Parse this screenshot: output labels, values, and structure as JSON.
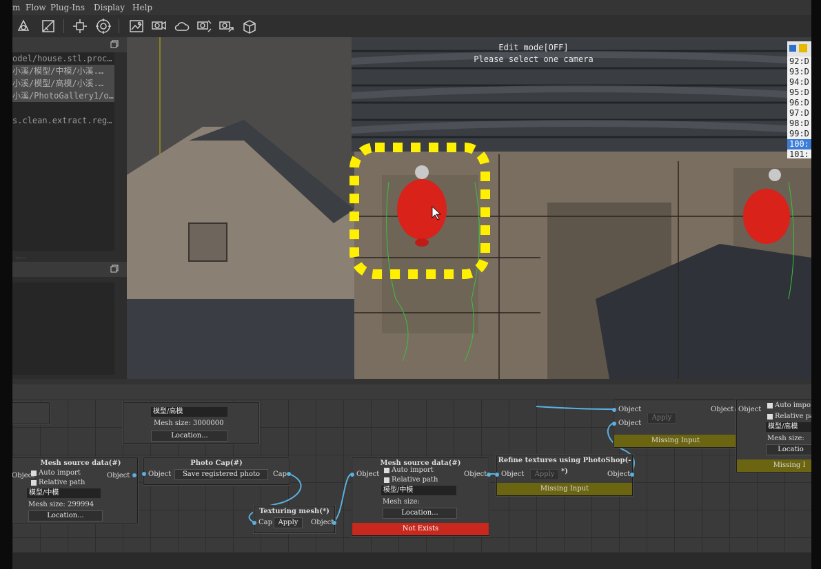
{
  "menu": [
    "m",
    "Flow",
    "Plug-Ins",
    "Display",
    "Help"
  ],
  "toolbar_icons": [
    "pointer-tool-icon",
    "perspective-icon",
    "transform-icon",
    "target-icon",
    "photo-icon",
    "camera-align-icon",
    "cloud-icon",
    "camera-settings-icon",
    "camera-export-icon",
    "cube-icon"
  ],
  "left_panel": {
    "files": [
      "odel/house.stl.proc…",
      "小溪/模型/中模/小溪.…",
      "小溪/模型/高模/小溪.…",
      "小溪/PhotoGallery1/o…",
      "",
      "s.clean.extract.reg…"
    ],
    "splitter_dots": "......"
  },
  "viewport": {
    "edit_mode": "Edit mode[OFF]",
    "hint": "Please select one camera",
    "cameras": [
      "92:D",
      "93:D",
      "94:D",
      "95:D",
      "96:D",
      "97:D",
      "98:D",
      "99:D",
      "100:",
      "101:"
    ],
    "selected_camera": "100:"
  },
  "graph": {
    "nodes": {
      "top_mesh": {
        "field": "模型/高模",
        "size": "Mesh size: 3000000",
        "location": "Location..."
      },
      "mesh_mid": {
        "title": "Mesh source data(#)",
        "in": "Object",
        "out": "Object",
        "auto": "Auto import",
        "rel": "Relative path",
        "field": "模型/中模",
        "size": "Mesh size: 299994",
        "location": "Location..."
      },
      "photo_cap": {
        "title": "Photo Cap(#)",
        "in": "Object",
        "action": "Save registered photo album",
        "out": "Cap"
      },
      "texturing": {
        "title": "Texturing mesh(*)",
        "in": "Cap",
        "apply": "Apply",
        "out": "Object"
      },
      "mesh_src": {
        "title": "Mesh source data(#)",
        "in": "Object",
        "out": "Object",
        "auto": "Auto import",
        "rel": "Relative path",
        "field": "模型/中模",
        "size": "Mesh size:",
        "location": "Location...",
        "status": "Not Exists"
      },
      "refine": {
        "title": "Refine textures using PhotoShop(-*)",
        "in": "Object",
        "apply": "Apply",
        "out": "Object",
        "status": "Missing Input"
      },
      "top_apply": {
        "in1": "Object",
        "in2": "Object",
        "apply": "Apply",
        "status": "Missing Input"
      },
      "right_mesh": {
        "in": "Object",
        "out_left": "Object",
        "auto": "Auto impo",
        "rel": "Relative pa",
        "field": "模型/高模",
        "size": "Mesh size:",
        "location": "Locatio",
        "status": "Missing I"
      }
    }
  },
  "colors": {
    "accent": "#5ab0e0",
    "missing": "#6b6410",
    "not_exists": "#c8281e",
    "highlight": "#ffef00"
  }
}
